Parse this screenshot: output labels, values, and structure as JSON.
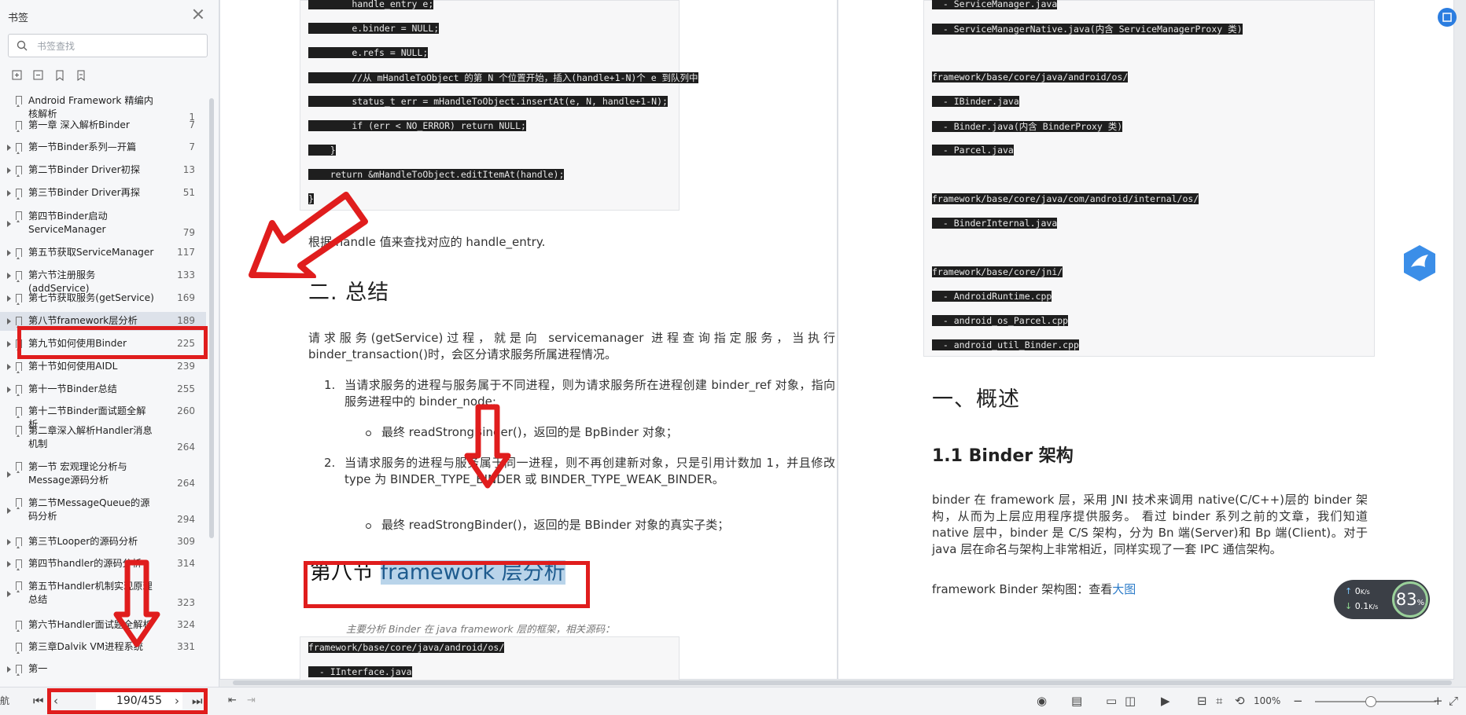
{
  "sidebar": {
    "title": "书签",
    "search_placeholder": "书签查找",
    "items": [
      {
        "label": "Android Framework 精编内核解析",
        "page": "1",
        "arrow": false
      },
      {
        "label": "第一章 深入解析Binder",
        "page": "7",
        "arrow": false
      },
      {
        "label": "第一节Binder系列—开篇",
        "page": "7",
        "arrow": true
      },
      {
        "label": "第二节Binder Driver初探",
        "page": "13",
        "arrow": true
      },
      {
        "label": "第三节Binder Driver再探",
        "page": "51",
        "arrow": true
      },
      {
        "label": "第四节Binder启动ServiceManager",
        "page": "79",
        "arrow": true
      },
      {
        "label": "第五节获取ServiceManager",
        "page": "117",
        "arrow": true
      },
      {
        "label": "第六节注册服务(addService)",
        "page": "133",
        "arrow": true
      },
      {
        "label": "第七节获取服务(getService)",
        "page": "169",
        "arrow": true
      },
      {
        "label": "第八节framework层分析",
        "page": "189",
        "arrow": true,
        "selected": true
      },
      {
        "label": "第九节如何使用Binder",
        "page": "225",
        "arrow": true
      },
      {
        "label": "第十节如何使用AIDL",
        "page": "239",
        "arrow": true
      },
      {
        "label": "第十一节Binder总结",
        "page": "255",
        "arrow": true
      },
      {
        "label": "第十二节Binder面试题全解析",
        "page": "260",
        "arrow": false
      },
      {
        "label": "第二章深入解析Handler消息机制",
        "page": "264",
        "arrow": false
      },
      {
        "label": "第一节 宏观理论分析与Message源码分析",
        "page": "264",
        "arrow": true
      },
      {
        "label": "第二节MessageQueue的源码分析",
        "page": "294",
        "arrow": true
      },
      {
        "label": "第三节Looper的源码分析",
        "page": "309",
        "arrow": true
      },
      {
        "label": "第四节handler的源码分析",
        "page": "314",
        "arrow": true
      },
      {
        "label": "第五节Handler机制实现原理总结",
        "page": "323",
        "arrow": true
      },
      {
        "label": "第六节Handler面试题全解析",
        "page": "324",
        "arrow": false
      },
      {
        "label": "第三章Dalvik VM进程系统",
        "page": "331",
        "arrow": false
      },
      {
        "label": "第一",
        "page": "",
        "arrow": true
      }
    ]
  },
  "bottom": {
    "nav_label": "航",
    "page_indicator": "190/455",
    "zoom": "100%"
  },
  "page1": {
    "code_top": [
      "        handle_entry e;",
      "        e.binder = NULL;",
      "        e.refs = NULL;",
      "        //从 mHandleToObject 的第 N 个位置开始，插入(handle+1-N)个 e 到队列中",
      "        status_t err = mHandleToObject.insertAt(e, N, handle+1-N);",
      "        if (err < NO_ERROR) return NULL;",
      "    }",
      "    return &mHandleToObject.editItemAt(handle);",
      "}"
    ],
    "para_handle": "根据 handle 值来查找对应的 handle_entry.",
    "h_summary": "二. 总结",
    "para_summary": "请求服务(getService)过程，就是向 servicemanager 进程查询指定服务，当执行binder_transaction()时，会区分请求服务所属进程情况。",
    "list1_num": "1.",
    "list1_text": "当请求服务的进程与服务属于不同进程，则为请求服务所在进程创建 binder_ref 对象，指向服务进程中的 binder_node;",
    "list1_sub": "最终 readStrongBinder()，返回的是 BpBinder 对象；",
    "list2_num": "2.",
    "list2_text": "当请求服务的进程与服务属于同一进程，则不再创建新对象，只是引用计数加 1，并且修改 type 为 BINDER_TYPE_BINDER 或 BINDER_TYPE_WEAK_BINDER。",
    "list2_sub": "最终 readStrongBinder()，返回的是 BBinder 对象的真实子类；",
    "section_prefix": "第八节 ",
    "section_highlight": "framework 层分析",
    "subnote": "主要分析 Binder 在 java framework 层的框架，相关源码：",
    "code_bottom": [
      "framework/base/core/java/android/os/",
      "  - IInterface.java"
    ]
  },
  "page2": {
    "code_lines": [
      "  - ServiceManager.java",
      "  - ServiceManagerNative.java(内含 ServiceManagerProxy 类)",
      "",
      "framework/base/core/java/android/os/",
      "  - IBinder.java",
      "  - Binder.java(内含 BinderProxy 类)",
      "  - Parcel.java",
      "",
      "framework/base/core/java/com/android/internal/os/",
      "  - BinderInternal.java",
      "",
      "framework/base/core/jni/",
      "  - AndroidRuntime.cpp",
      "  - android_os_Parcel.cpp",
      "  - android_util_Binder.cpp"
    ],
    "h_overview": "一、概述",
    "h_arch": "1.1 Binder 架构",
    "para_arch": "binder 在 framework 层，采用 JNI 技术来调用 native(C/C++)层的 binder 架构，从而为上层应用程序提供服务。 看过 binder 系列之前的文章，我们知道 native 层中，binder 是 C/S 架构，分为 Bn 端(Server)和 Bp 端(Client)。对于 java 层在命名与架构上非常相近，同样实现了一套 IPC 通信架构。",
    "para_diagram": "framework Binder 架构图：查看",
    "diagram_link": "大图"
  },
  "widget": {
    "up": "0",
    "down": "0.1",
    "unit": "K/s",
    "pct": "83",
    "pct_unit": "%"
  },
  "colors": {
    "red_annotation": "#e01d1d",
    "accent": "#2d7cc9"
  }
}
